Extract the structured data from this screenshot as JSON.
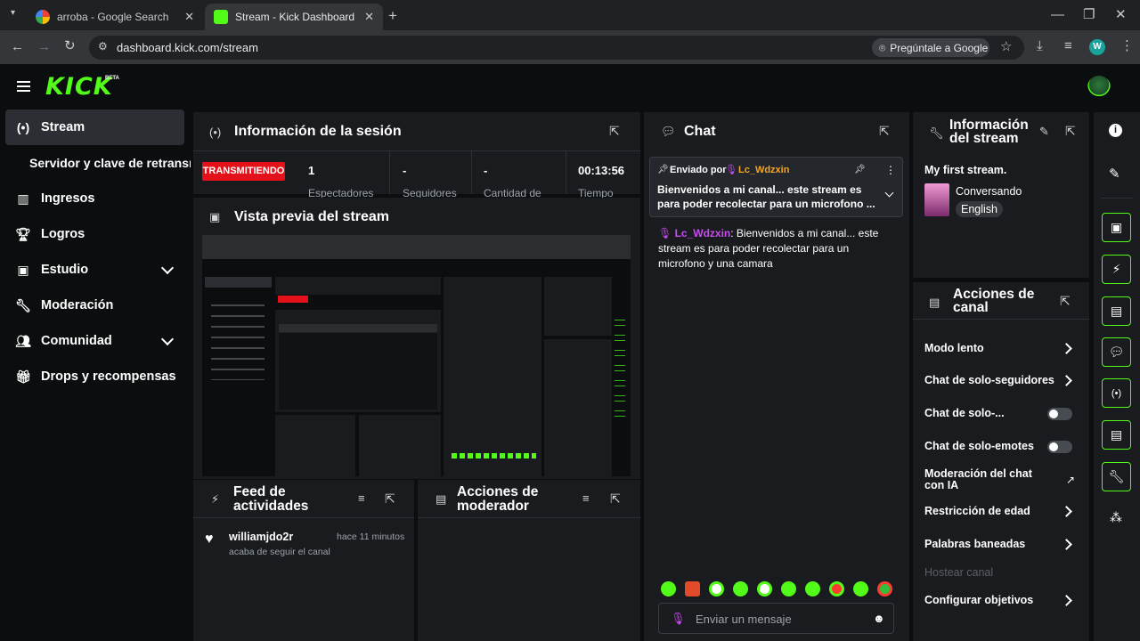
{
  "browser": {
    "tabs": [
      {
        "title": "arroba - Google Search"
      },
      {
        "title": "Stream - Kick Dashboard"
      }
    ],
    "url": "dashboard.kick.com/stream",
    "ask_google": "Pregúntale a Google",
    "profile_initial": "W"
  },
  "brand": {
    "logo": "KICK",
    "beta": "BETA",
    "accent": "#53fc18"
  },
  "sidebar": {
    "items": [
      {
        "label": "Stream",
        "icon": "broadcast-icon"
      },
      {
        "label": "Servidor y clave de retransmisión"
      },
      {
        "label": "Ingresos",
        "icon": "chart-icon"
      },
      {
        "label": "Logros",
        "icon": "trophy-icon"
      },
      {
        "label": "Estudio",
        "icon": "studio-icon"
      },
      {
        "label": "Moderación",
        "icon": "wrench-icon"
      },
      {
        "label": "Comunidad",
        "icon": "community-icon"
      },
      {
        "label": "Drops y recompensas",
        "icon": "gift-icon"
      }
    ]
  },
  "session": {
    "title": "Información de la sesión",
    "live_badge": "TRANSMITIENDO",
    "stats": [
      {
        "value": "1",
        "label": "Espectadores"
      },
      {
        "value": "-",
        "label": "Seguidores"
      },
      {
        "value": "-",
        "label": "Cantidad de"
      },
      {
        "value": "00:13:56",
        "label": "Tiempo"
      }
    ]
  },
  "preview": {
    "title": "Vista previa del stream"
  },
  "activity": {
    "title_line1": "Feed de",
    "title_line2": "actividades",
    "items": [
      {
        "user": "williamjdo2r",
        "time": "hace 11 minutos",
        "text": "acaba de seguir el canal"
      }
    ]
  },
  "mod_actions": {
    "title_line1": "Acciones de",
    "title_line2": "moderador"
  },
  "chat": {
    "title": "Chat",
    "pinned_by_label": "Enviado por",
    "pinned_user": "Lc_Wdzxin",
    "pinned_text": "Bienvenidos a mi canal... este stream es para poder recolectar para un microfono ...",
    "message_user": "Lc_Wdzxin",
    "message_text": ": Bienvenidos a mi canal... este stream es para poder recolectar para un microfono y una camara",
    "input_placeholder": "Enviar un mensaje"
  },
  "stream_info": {
    "title_line1": "Información",
    "title_line2": "del stream",
    "stream_title": "My first stream.",
    "category": "Conversando",
    "language": "English"
  },
  "channel_actions": {
    "title_line1": "Acciones de",
    "title_line2": "canal",
    "items": [
      {
        "label": "Modo lento",
        "control": "arrow"
      },
      {
        "label": "Chat de solo-seguidores",
        "control": "arrow"
      },
      {
        "label": "Chat de solo-...",
        "control": "toggle"
      },
      {
        "label": "Chat de solo-emotes",
        "control": "toggle"
      },
      {
        "label": "Moderación del chat con IA",
        "control": "external"
      },
      {
        "label": "Restricción de edad",
        "control": "arrow"
      },
      {
        "label": "Palabras baneadas",
        "control": "arrow"
      },
      {
        "label": "Hostear canal",
        "control": "disabled"
      },
      {
        "label": "Configurar objetivos",
        "control": "arrow"
      }
    ]
  }
}
